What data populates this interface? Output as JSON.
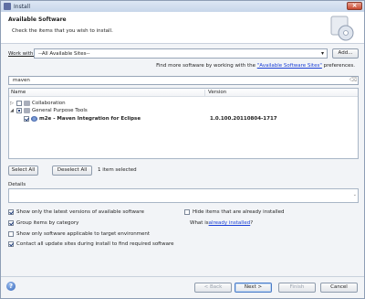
{
  "window": {
    "title": "Install"
  },
  "header": {
    "title": "Available Software",
    "description": "Check the items that you wish to install."
  },
  "work_with": {
    "label": "Work with:",
    "value": "--All Available Sites--",
    "add_label": "Add..."
  },
  "find_more": {
    "prefix": "Find more software by working with the ",
    "link": "\"Available Software Sites\"",
    "suffix": " preferences."
  },
  "filter": {
    "value": "maven"
  },
  "tree": {
    "columns": [
      "Name",
      "Version"
    ],
    "rows": [
      {
        "label": "Collaboration",
        "version": "",
        "expanded": false,
        "checked": "none"
      },
      {
        "label": "General Purpose Tools",
        "version": "",
        "expanded": true,
        "checked": "partial"
      },
      {
        "label": "m2e - Maven Integration for Eclipse",
        "version": "1.0.100.20110804-1717",
        "checked": "checked"
      }
    ]
  },
  "actions": {
    "select_all": "Select All",
    "deselect_all": "Deselect All",
    "selection_info": "1 item selected"
  },
  "details": {
    "label": "Details"
  },
  "options": {
    "latest_versions": "Show only the latest versions of available software",
    "group_by_category": "Group items by category",
    "target_environment": "Show only software applicable to target environment",
    "contact_sites": "Contact all update sites during install to find required software",
    "hide_installed": "Hide items that are already installed",
    "what_is_prefix": "What is ",
    "already_installed_link": "already installed",
    "what_is_suffix": "?"
  },
  "footer": {
    "back": "< Back",
    "next": "Next >",
    "finish": "Finish",
    "cancel": "Cancel"
  }
}
